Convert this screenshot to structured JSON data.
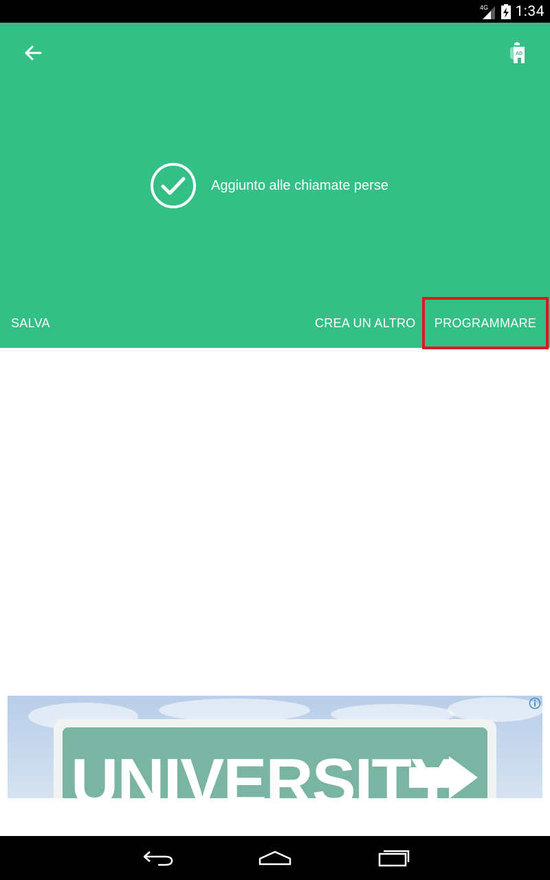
{
  "status_bar": {
    "network_label": "4G",
    "time": "1:34"
  },
  "header": {
    "background_color": "#33bf86",
    "back_icon": "arrow-left-icon",
    "ad_icon": "ad-block-icon",
    "ad_icon_text": "AD"
  },
  "confirmation": {
    "icon": "check-circle-icon",
    "message": "Aggiunto alle chiamate perse"
  },
  "actions": {
    "save_label": "SALVA",
    "create_another_label": "CREA UN ALTRO",
    "schedule_label": "PROGRAMMARE",
    "highlight_color": "#e8141d"
  },
  "ad_banner": {
    "headline": "UNIVERSITY",
    "info_icon": "info-icon"
  },
  "nav_bar": {
    "back_icon": "nav-back-icon",
    "home_icon": "nav-home-icon",
    "recents_icon": "nav-recents-icon"
  }
}
